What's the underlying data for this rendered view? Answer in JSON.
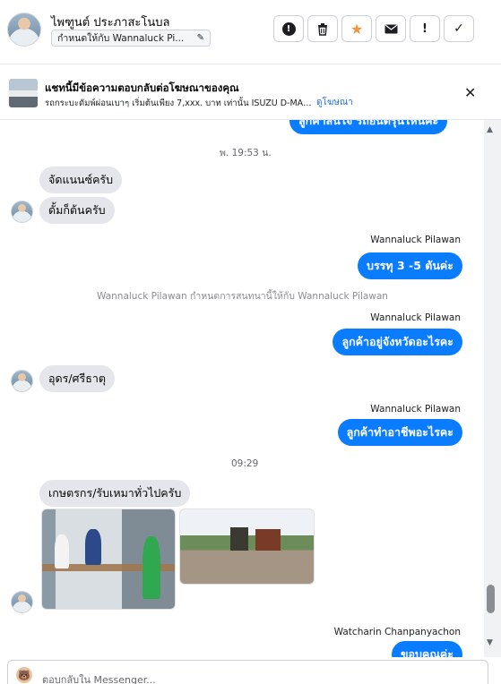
{
  "header": {
    "contact_name": "ไพฑูนต์ ประภาสะโนบล",
    "assign_label": "กำหนดให้กับ Wannaluck Pi...",
    "tools": [
      {
        "name": "spam",
        "glyph": "!"
      },
      {
        "name": "delete",
        "glyph": "🗑"
      },
      {
        "name": "star",
        "glyph": "★"
      },
      {
        "name": "mail",
        "glyph": "✉"
      },
      {
        "name": "follow-up",
        "glyph": "!"
      },
      {
        "name": "done",
        "glyph": "✓"
      }
    ]
  },
  "ad": {
    "title": "แชทนี้มีข้อความตอบกลับต่อโฆษณาของคุณ",
    "subtitle": "รถกระบะดัมพ์ผ่อนเบาๆ เริ่มต้นเพียง 7,xxx. บาท เท่านั้น ISUZU D-MAX ALL...",
    "link": "ดูโฆษณา"
  },
  "chat": {
    "partial_outgoing_top": "ลูกค้าสนใจ รถยนต์รุ่นไหนคะ",
    "messages": [
      {
        "type": "timestamp",
        "text": "พ. 19:53 น."
      },
      {
        "type": "in",
        "text": "จัดแนนซ์ครับ"
      },
      {
        "type": "in",
        "text": "ดั้มก็ต้นครับ"
      },
      {
        "type": "sender",
        "text": "Wannaluck Pilawan"
      },
      {
        "type": "out",
        "text": "บรรทุ 3 -5 ตันค่ะ"
      },
      {
        "type": "system",
        "text": "Wannaluck Pilawan กำหนดการสนทนานี้ให้กับ Wannaluck Pilawan"
      },
      {
        "type": "sender",
        "text": "Wannaluck Pilawan"
      },
      {
        "type": "out",
        "text": "ลูกค้าอยู่จังหวัดอะไรคะ"
      },
      {
        "type": "in",
        "text": "อุดร/ศรีธาตุ"
      },
      {
        "type": "sender",
        "text": "Wannaluck Pilawan"
      },
      {
        "type": "out",
        "text": "ลูกค้าทำอาชีพอะไรคะ"
      },
      {
        "type": "timestamp",
        "text": "09:29"
      },
      {
        "type": "in",
        "text": "เกษตรกร/รับเหมาทั่วไปครับ"
      },
      {
        "type": "sender",
        "text": "Watcharin Chanpanyachon"
      },
      {
        "type": "out",
        "text": "ขอบคุณค่ะ"
      }
    ]
  },
  "composer": {
    "placeholder": "ตอบกลับใน Messenger..."
  },
  "colors": {
    "outgoing_bubble": "#0a7cff",
    "incoming_bubble": "#e4e6eb",
    "link": "#216fdb"
  }
}
